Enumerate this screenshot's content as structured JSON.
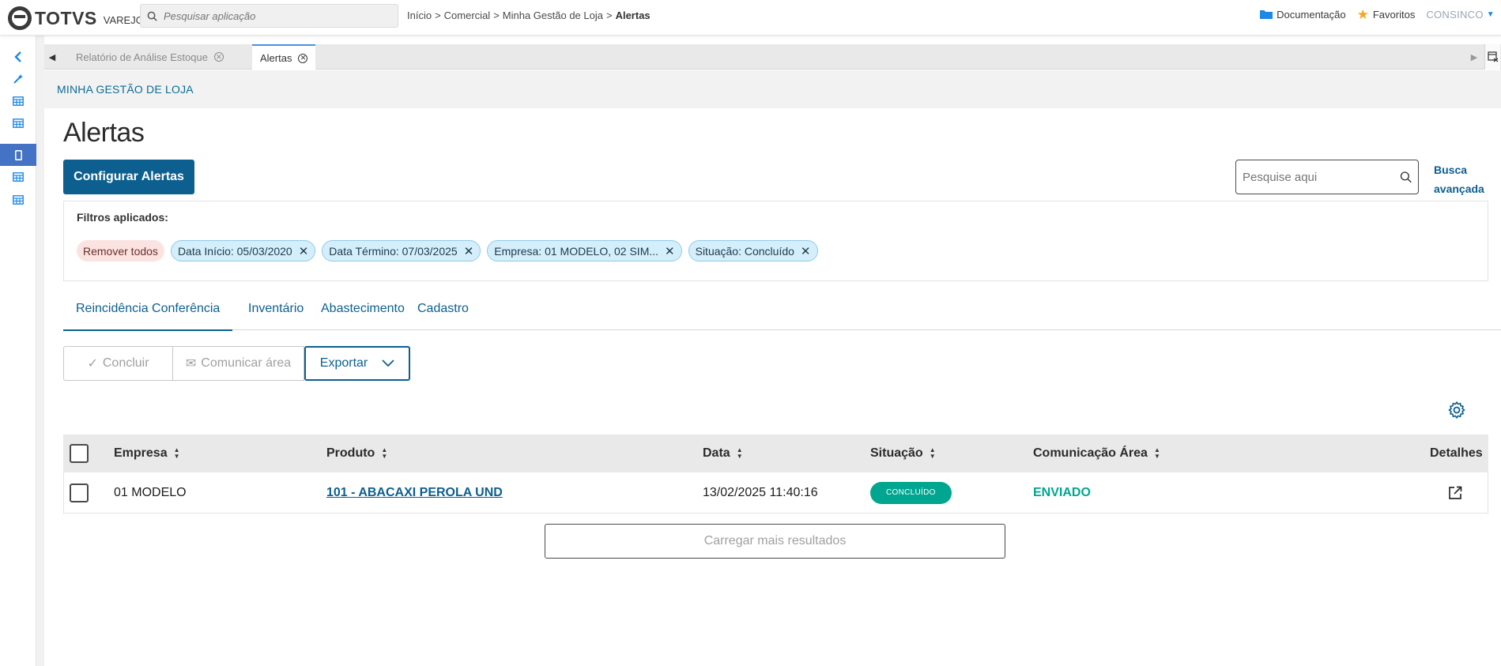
{
  "header": {
    "brand": "TOTVS",
    "brand_sub": "VAREJO",
    "search_placeholder": "Pesquisar aplicação",
    "breadcrumb": [
      "Início",
      ">",
      "Comercial",
      ">",
      "Minha Gestão de Loja",
      ">",
      "Alertas"
    ],
    "documentation": "Documentação",
    "favorites": "Favoritos",
    "user": "CONSINCO"
  },
  "window_tabs": [
    {
      "label": "Relatório de Análise Estoque",
      "active": false
    },
    {
      "label": "Alertas",
      "active": true
    }
  ],
  "sidebar": {
    "items": [
      "collapse",
      "tools",
      "grid",
      "grid",
      "mobile",
      "grid",
      "grid"
    ],
    "active_index": 4
  },
  "page": {
    "section": "MINHA GESTÃO DE LOJA",
    "title": "Alertas",
    "configure_button": "Configurar Alertas",
    "search_placeholder": "Pesquise aqui",
    "advanced_search_line1": "Busca",
    "advanced_search_line2": "avançada"
  },
  "filters": {
    "label": "Filtros aplicados:",
    "remove_all": "Remover todos",
    "chips": [
      "Data Início: 05/03/2020",
      "Data Término: 07/03/2025",
      "Empresa: 01 MODELO, 02 SIM...",
      "Situação: Concluído"
    ]
  },
  "tabs": [
    "Reincidência Conferência",
    "Inventário",
    "Abastecimento",
    "Cadastro"
  ],
  "actions": {
    "conclude": "Concluir",
    "communicate": "Comunicar área",
    "export": "Exportar"
  },
  "table": {
    "columns": [
      "Empresa",
      "Produto",
      "Data",
      "Situação",
      "Comunicação Área",
      "Detalhes"
    ],
    "rows": [
      {
        "empresa": "01 MODELO",
        "produto": "101 - ABACAXI PEROLA UND",
        "data": "13/02/2025 11:40:16",
        "situacao": "CONCLUÍDO",
        "comunicacao": "ENVIADO"
      }
    ]
  },
  "load_more": "Carregar mais resultados",
  "colors": {
    "primary": "#0c5f8f",
    "success": "#00a690",
    "sidebar_active": "#4472c4"
  }
}
